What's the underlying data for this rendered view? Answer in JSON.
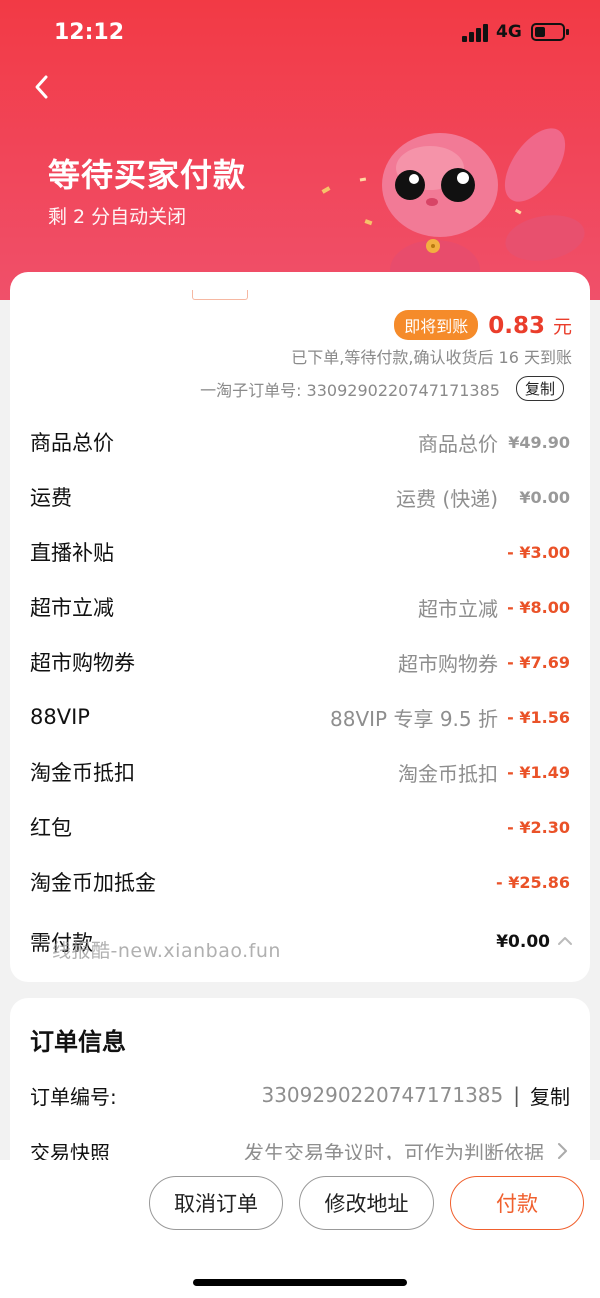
{
  "status_bar": {
    "time": "12:12",
    "network": "4G"
  },
  "header": {
    "title": "等待买家付款",
    "subtitle": "剩 2 分自动关闭",
    "back_icon": "chevron-left-icon",
    "mascot": "pink-bunny-mascot",
    "background_color": "#f23a45"
  },
  "earnings": {
    "badge": "即将到账",
    "amount": "0.83",
    "unit": "元",
    "note": "已下单,等待付款,确认收货后 16 天到账",
    "sub_order_label": "一淘子订单号: 3309290220747171385",
    "copy_label": "复制"
  },
  "price_lines": [
    {
      "label": "商品总价",
      "desc": "商品总价",
      "value": "¥49.90",
      "negative": false
    },
    {
      "label": "运费",
      "desc": "运费 (快递)",
      "value": "¥0.00",
      "negative": false
    },
    {
      "label": "直播补贴",
      "desc": "",
      "value": "- ¥3.00",
      "negative": true
    },
    {
      "label": "超市立减",
      "desc": "超市立减",
      "value": "- ¥8.00",
      "negative": true
    },
    {
      "label": "超市购物券",
      "desc": "超市购物券",
      "value": "- ¥7.69",
      "negative": true
    },
    {
      "label": "88VIP",
      "desc": "88VIP 专享 9.5 折",
      "value": "- ¥1.56",
      "negative": true
    },
    {
      "label": "淘金币抵扣",
      "desc": "淘金币抵扣",
      "value": "- ¥1.49",
      "negative": true
    },
    {
      "label": "红包",
      "desc": "",
      "value": "- ¥2.30",
      "negative": true
    },
    {
      "label": "淘金币加抵金",
      "desc": "",
      "value": "- ¥25.86",
      "negative": true
    }
  ],
  "total": {
    "label": "需付款",
    "value": "¥0.00"
  },
  "watermark": "线报酷-new.xianbao.fun",
  "order_info": {
    "title": "订单信息",
    "order_no_label": "订单编号:",
    "order_no": "3309290220747171385",
    "separator": "|",
    "copy_label": "复制",
    "snapshot_label": "交易快照",
    "snapshot_value": "发生交易争议时，可作为判断依据"
  },
  "actions": {
    "cancel": "取消订单",
    "modify_address": "修改地址",
    "pay": "付款"
  },
  "colors": {
    "accent": "#ea3d2b",
    "badge": "#f58b2a",
    "pay_button": "#f0602e",
    "negative_value": "#ea5228"
  }
}
